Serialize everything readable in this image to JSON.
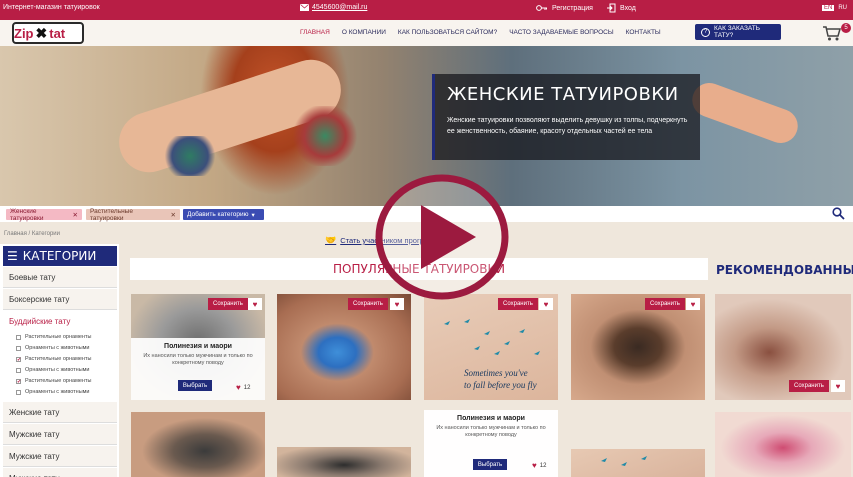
{
  "topbar": {
    "shop_name": "Интернет-магазин татуировок",
    "email": "4545600@mail.ru",
    "register_label": "Регистрация",
    "login_label": "Вход",
    "langs": [
      "EN",
      "RU"
    ]
  },
  "brand": {
    "logo_left": "Zip",
    "logo_right": "tat"
  },
  "menu": [
    "ГЛАВНАЯ",
    "О КОМПАНИИ",
    "КАК ПОЛЬЗОВАТЬСЯ САЙТОМ?",
    "ЧАСТО ЗАДАВАЕМЫЕ ВОПРОСЫ",
    "КОНТАКТЫ"
  ],
  "order_button": "КАК ЗАКАЗАТЬ ТАТУ?",
  "cart_count": "5",
  "hero": {
    "title": "ЖЕНСКИЕ ТАТУИРОВКИ",
    "text": "Женские татуировки позволяют выделить девушку из толпы, подчеркнуть ее женственность, обаяние, красоту отдельных частей ее тела"
  },
  "filters": {
    "chip1": "Женские татуировки",
    "chip2": "Растительные татуировки",
    "add": "Добавить категорию"
  },
  "breadcrumb": "Главная / Категории",
  "partner_link": "Стать участником программы",
  "sidebar": {
    "title": "КАТЕГОРИИ",
    "items": [
      "Боевые тату",
      "Боксерские тату",
      "Буддийские тату",
      "Женские тату",
      "Мужские тату",
      "Мужские тату",
      "Мужские тату"
    ],
    "subitems": [
      {
        "label": "Растительные орнаменты",
        "checked": false
      },
      {
        "label": "Орнаменты с животными",
        "checked": false
      },
      {
        "label": "Растительные орнаменты",
        "checked": true
      },
      {
        "label": "Орнаменты с животными",
        "checked": false
      },
      {
        "label": "Растительные орнаменты",
        "checked": true
      },
      {
        "label": "Орнаменты с животными",
        "checked": false
      }
    ]
  },
  "popular_title": "ПОПУЛЯРНЫЕ ТАТУИРОВКИ",
  "recommended_title": "РЕКОМЕНДОВАННЫЕ",
  "card": {
    "save": "Сохранить",
    "title": "Полинезия и маори",
    "desc": "Их наносили только мужчинам и только по конкретному поводу",
    "choose": "Выбрать",
    "likes": "12"
  },
  "colors": {
    "brand": "#b81e45",
    "navy": "#1f2a7a"
  }
}
